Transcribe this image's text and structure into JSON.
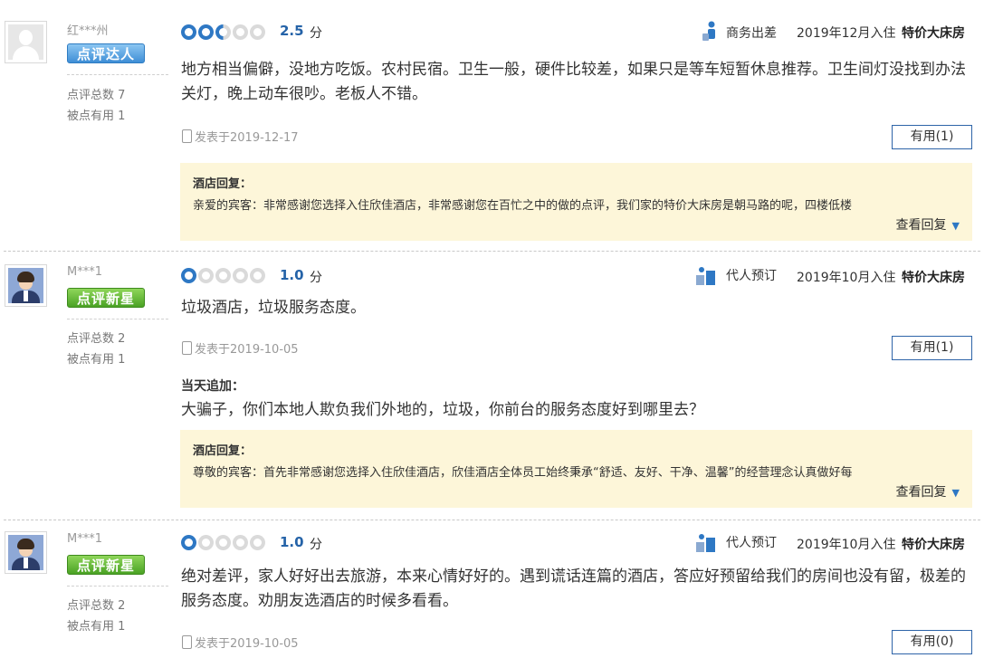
{
  "reviews": [
    {
      "user": {
        "name": "红***州",
        "badge": "点评达人",
        "badge_color": "#3e8ed6",
        "review_count": "点评总数 7",
        "useful_count": "被点有用 1",
        "avatar": "default-avatar"
      },
      "rating": {
        "score": "2.5",
        "unit": "分",
        "value": 2.5,
        "max": 5
      },
      "trip_type": "商务出差",
      "trip_icon": "business-trip-icon",
      "stay_date": "2019年12月入住",
      "room_type": "特价大床房",
      "content": "地方相当偏僻，没地方吃饭。农村民宿。卫生一般，硬件比较差，如果只是等车短暂休息推荐。卫生间灯没找到办法关灯，晚上动车很吵。老板人不错。",
      "posted": "发表于2019-12-17",
      "useful_button": "有用(1)",
      "reply": {
        "title": "酒店回复：",
        "text": "亲爱的宾客：非常感谢您选择入住欣佳酒店，非常感谢您在百忙之中的做的点评，我们家的特价大床房是朝马路的呢，四楼低楼",
        "more": "查看回复"
      }
    },
    {
      "user": {
        "name": "M***1",
        "badge": "点评新星",
        "badge_color": "#4aa224",
        "review_count": "点评总数 2",
        "useful_count": "被点有用 1",
        "avatar": "person-avatar"
      },
      "rating": {
        "score": "1.0",
        "unit": "分",
        "value": 1,
        "max": 5
      },
      "trip_type": "代人预订",
      "trip_icon": "booking-for-others-icon",
      "stay_date": "2019年10月入住",
      "room_type": "特价大床房",
      "content": "垃圾酒店，垃圾服务态度。",
      "posted": "发表于2019-10-05",
      "useful_button": "有用(1)",
      "addition": {
        "title": "当天追加：",
        "text": "大骗子，你们本地人欺负我们外地的，垃圾，你前台的服务态度好到哪里去？"
      },
      "reply": {
        "title": "酒店回复：",
        "text": "尊敬的宾客：首先非常感谢您选择入住欣佳酒店，欣佳酒店全体员工始终秉承“舒适、友好、干净、温馨”的经营理念认真做好每",
        "more": "查看回复"
      }
    },
    {
      "user": {
        "name": "M***1",
        "badge": "点评新星",
        "badge_color": "#4aa224",
        "review_count": "点评总数 2",
        "useful_count": "被点有用 1",
        "avatar": "person-avatar"
      },
      "rating": {
        "score": "1.0",
        "unit": "分",
        "value": 1,
        "max": 5
      },
      "trip_type": "代人预订",
      "trip_icon": "booking-for-others-icon",
      "stay_date": "2019年10月入住",
      "room_type": "特价大床房",
      "content": "绝对差评，家人好好出去旅游，本来心情好好的。遇到谎话连篇的酒店，答应好预留给我们的房间也没有留，极差的服务态度。劝朋友选酒店的时候多看看。",
      "posted": "发表于2019-10-05",
      "useful_button": "有用(0)"
    }
  ]
}
